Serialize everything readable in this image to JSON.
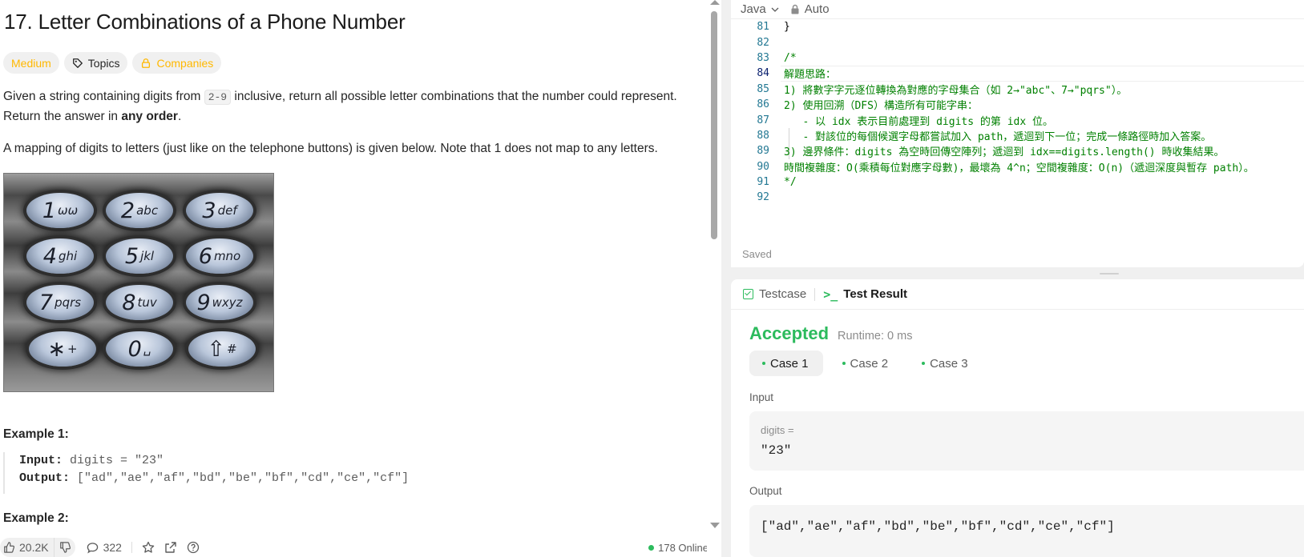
{
  "problem": {
    "title": "17. Letter Combinations of a Phone Number",
    "difficulty": "Medium",
    "topics_label": "Topics",
    "companies_label": "Companies",
    "desc1_a": "Given a string containing digits from ",
    "desc1_code": "2-9",
    "desc1_b": " inclusive, return all possible letter combinations that the number could represent.",
    "desc1_c": "Return the answer in ",
    "desc1_bold": "any order",
    "desc1_d": ".",
    "desc2": "A mapping of digits to letters (just like on the telephone buttons) is given below. Note that 1 does not map to any letters.",
    "keypad": [
      {
        "num": "1",
        "letters": "ωω"
      },
      {
        "num": "2",
        "letters": "abc"
      },
      {
        "num": "3",
        "letters": "def"
      },
      {
        "num": "4",
        "letters": "ghi"
      },
      {
        "num": "5",
        "letters": "jkl"
      },
      {
        "num": "6",
        "letters": "mno"
      },
      {
        "num": "7",
        "letters": "pqrs"
      },
      {
        "num": "8",
        "letters": "tuv"
      },
      {
        "num": "9",
        "letters": "wxyz"
      },
      {
        "num": "∗",
        "letters": "+"
      },
      {
        "num": "0",
        "letters": "␣"
      },
      {
        "num": "⇧",
        "letters": "#"
      }
    ],
    "example1_title": "Example 1:",
    "example1_input_label": "Input:",
    "example1_input": " digits = \"23\"",
    "example1_output_label": "Output:",
    "example1_output": " [\"ad\",\"ae\",\"af\",\"bd\",\"be\",\"bf\",\"cd\",\"ce\",\"cf\"]",
    "example2_title": "Example 2:"
  },
  "footer": {
    "likes": "20.2K",
    "comments": "322",
    "online": "178 Online"
  },
  "editor": {
    "language": "Java",
    "mode": "Auto",
    "saved": "Saved",
    "lines": [
      {
        "n": "81",
        "t": "}",
        "k": "black"
      },
      {
        "n": "82",
        "t": "",
        "k": "black"
      },
      {
        "n": "83",
        "t": "/*",
        "k": "comment"
      },
      {
        "n": "84",
        "t": "解題思路：",
        "k": "comment"
      },
      {
        "n": "85",
        "t": "1) 將數字字元逐位轉換為對應的字母集合（如 2→\"abc\"、7→\"pqrs\"）。",
        "k": "comment"
      },
      {
        "n": "86",
        "t": "2) 使用回溯（DFS）構造所有可能字串：",
        "k": "comment"
      },
      {
        "n": "87",
        "t": "   - 以 idx 表示目前處理到 digits 的第 idx 位。",
        "k": "comment"
      },
      {
        "n": "88",
        "t": "   - 對該位的每個候選字母都嘗試加入 path，遞迴到下一位；完成一條路徑時加入答案。",
        "k": "comment"
      },
      {
        "n": "89",
        "t": "3) 邊界條件：digits 為空時回傳空陣列；遞迴到 idx==digits.length() 時收集結果。",
        "k": "comment"
      },
      {
        "n": "90",
        "t": "時間複雜度：O(乘積每位對應字母數)，最壞為 4^n；空間複雜度：O(n)（遞迴深度與暫存 path）。",
        "k": "comment"
      },
      {
        "n": "91",
        "t": "*/",
        "k": "comment"
      },
      {
        "n": "92",
        "t": "",
        "k": "black"
      }
    ]
  },
  "result": {
    "tab_testcase": "Testcase",
    "tab_result": "Test Result",
    "status": "Accepted",
    "runtime": "Runtime: 0 ms",
    "cases": [
      "Case 1",
      "Case 2",
      "Case 3"
    ],
    "input_label": "Input",
    "input_name": "digits =",
    "input_value": "\"23\"",
    "output_label": "Output",
    "output_value": "[\"ad\",\"ae\",\"af\",\"bd\",\"be\",\"bf\",\"cd\",\"ce\",\"cf\"]"
  },
  "colors": {
    "accepted": "#2cbb5d",
    "medium": "#ffb800",
    "comment": "#008000"
  }
}
